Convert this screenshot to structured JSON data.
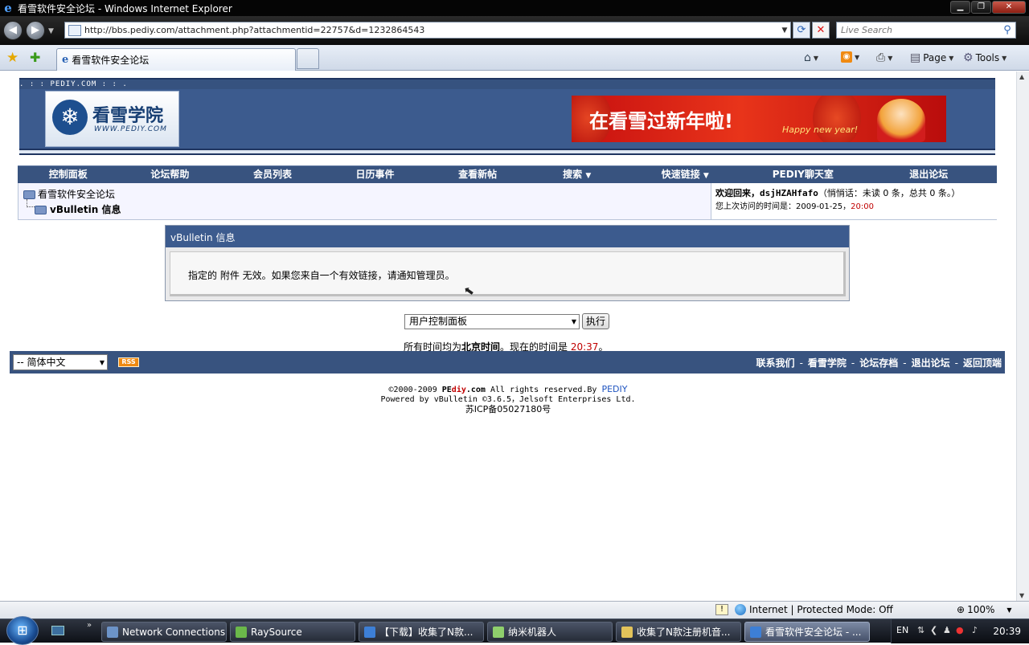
{
  "window": {
    "title": "看雪软件安全论坛 - Windows Internet Explorer",
    "url": "http://bbs.pediy.com/attachment.php?attachmentid=22757&d=1232864543",
    "search_placeholder": "Live Search",
    "tab_label": "看雪软件安全论坛",
    "commands": {
      "page": "Page",
      "tools": "Tools"
    }
  },
  "site": {
    "strip_text": ". : : PEDIY.COM : : .",
    "logo_title": "看雪学院",
    "logo_sub": "WWW.PEDIY.COM",
    "banner_text": "在看雪过新年啦!",
    "banner_sub": "Happy new year!"
  },
  "navbar": {
    "items": [
      "控制面板",
      "论坛帮助",
      "会员列表",
      "日历事件",
      "查看新帖",
      "搜索",
      "快速链接",
      "PEDIY聊天室",
      "退出论坛"
    ]
  },
  "breadcrumb": {
    "root": "看雪软件安全论坛",
    "current": "vBulletin 信息"
  },
  "welcome": {
    "prefix": "欢迎回来，",
    "username": "dsjHZAHfafo",
    "pm": "（悄悄话：未读 0 条，总共 0 条。）",
    "last_visit_label": "您上次访问的时间是：2009-01-25，",
    "last_visit_time": "20:00"
  },
  "info_panel": {
    "title": "vBulletin 信息",
    "message": "指定的 附件 无效。如果您来自一个有效链接，请通知管理员。"
  },
  "jump": {
    "selected": "用户控制面板",
    "go_label": "执行"
  },
  "timezone": {
    "prefix": "所有时间均为",
    "zone": "北京时间",
    "middle": "。现在的时间是 ",
    "now": "20:37",
    "suffix": "。"
  },
  "footer": {
    "language": "-- 简体中文",
    "rss": "RSS",
    "links": [
      "联系我们",
      "看雪学院",
      "论坛存档",
      "退出论坛",
      "返回顶端"
    ],
    "separator": "-"
  },
  "copyright": {
    "line1_prefix": "©2000-2009 ",
    "brand_pe": "PE",
    "brand_diy": "diy",
    "brand_com": ".com",
    "line1_mid": " All rights reserved.By ",
    "line1_link": "PEDIY",
    "line2": "Powered by vBulletin ©3.6.5，Jelsoft Enterprises Ltd.",
    "line3": "苏ICP备05027180号"
  },
  "statusbar": {
    "zone": "Internet | Protected Mode: Off",
    "zoom": "100%"
  },
  "taskbar": {
    "tasks": [
      "Network Connections",
      "RaySource",
      "【下载】收集了N款...",
      "纳米机器人",
      "收集了N款注册机音...",
      "看雪软件安全论坛 - ..."
    ],
    "lang": "EN",
    "clock": "20:39"
  },
  "colors": {
    "forum_blue": "#38537f",
    "alert_red": "#c00000"
  }
}
